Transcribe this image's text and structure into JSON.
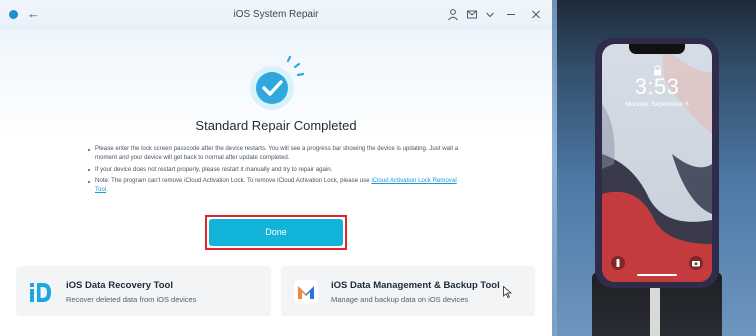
{
  "window": {
    "title": "iOS System Repair"
  },
  "titlebar_icons": [
    "app-logo-icon",
    "back-arrow-icon",
    "user-icon",
    "mail-icon",
    "chevron-down-icon",
    "minimize-icon",
    "close-icon"
  ],
  "repair": {
    "heading": "Standard Repair Completed",
    "notes": [
      "Please enter the lock screen passcode after the device restarts. You will see a progress bar showing the device is updating. Just wait a moment and your device will get back to normal after update completed.",
      "If your device does not restart properly, please restart it manually and try to repair again."
    ],
    "note3_prefix": "Note: The program can't remove iCloud Activation Lock. To remove iCloud Activation Lock, please use ",
    "note3_link": "iCloud Activation Lock Removal Tool",
    "note3_suffix": ".",
    "done_label": "Done"
  },
  "tools": [
    {
      "title": "iOS Data Recovery Tool",
      "subtitle": "Recover deleted data from iOS devices",
      "icon": "data-recovery-icon"
    },
    {
      "title": "iOS Data Management & Backup Tool",
      "subtitle": "Manage and backup data on iOS devices",
      "icon": "data-management-icon"
    }
  ],
  "phone": {
    "time": "3:53",
    "date": "Monday, September 6"
  },
  "colors": {
    "accent": "#13b4d9",
    "highlight_outline": "#e0262d",
    "badge_outer": "#d8f2fb",
    "badge_inner": "#2fa9dd",
    "link": "#1a9bd7"
  }
}
